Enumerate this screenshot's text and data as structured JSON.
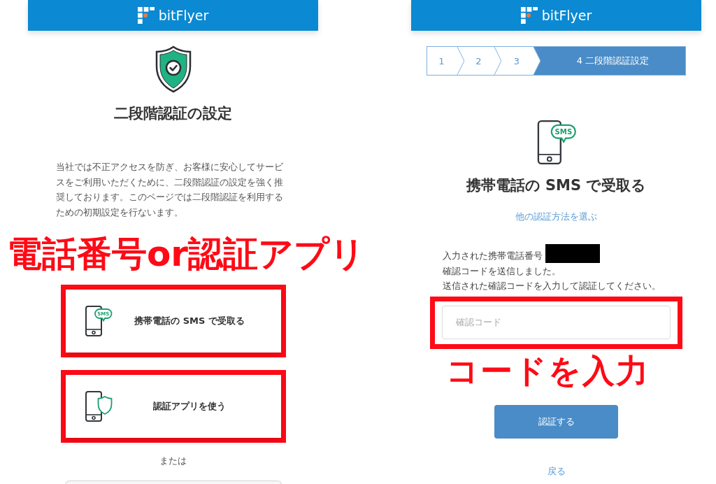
{
  "left_screen": {
    "header": {
      "brand": "bitFlyer"
    },
    "title": "二段階認証の設定",
    "intro": "当社では不正アクセスを防ぎ、お客様に安心してサービスをご利用いただくために、二段階認証の設定を強く推奨しております。このページでは二段階認証を利用するための初期設定を行ないます。",
    "annotation": "電話番号or認証アプリ",
    "options": [
      {
        "kind": "sms",
        "badge": "SMS",
        "label": "携帯電話の SMS で受取る",
        "highlighted": true
      },
      {
        "kind": "app",
        "label": "認証アプリを使う",
        "highlighted": true
      }
    ],
    "separator": "または"
  },
  "right_screen": {
    "header": {
      "brand": "bitFlyer"
    },
    "steps": [
      {
        "label": "1",
        "selected": false
      },
      {
        "label": "2",
        "selected": false
      },
      {
        "label": "3",
        "selected": false
      },
      {
        "label": "4 二段階認証設定",
        "selected": true
      }
    ],
    "icon_badge": "SMS",
    "title": "携帯電話の SMS で受取る",
    "other_method_link": "他の認証方法を選ぶ",
    "notice": {
      "before": "入力された携帯電話番号",
      "redacted": true,
      "after": "確認コードを送信しました。"
    },
    "instruction": "送信された確認コードを入力して認証してください。",
    "code_field": {
      "placeholder": "確認コード",
      "highlighted": true
    },
    "annotation": "コードを入力",
    "submit_button": "認証する",
    "back_link": "戻る"
  }
}
